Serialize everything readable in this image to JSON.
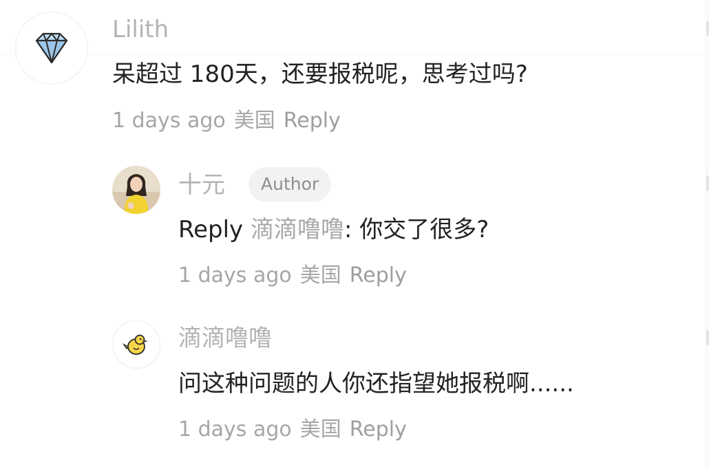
{
  "comments": [
    {
      "username": "Lilith",
      "avatar_icon": "diamond-icon",
      "text": "呆超过 180天，还要报税呢，思考过吗?",
      "time": "1 days ago",
      "location": "美国",
      "reply_label": "Reply",
      "replies": [
        {
          "username": "十元",
          "badge": "Author",
          "avatar_icon": "user-photo-avatar",
          "reply_prefix": "Reply",
          "reply_to": "滴滴噜噜",
          "text": ": 你交了很多?",
          "time": "1 days ago",
          "location": "美国",
          "reply_label": "Reply"
        },
        {
          "username": "滴滴噜噜",
          "avatar_icon": "duck-icon",
          "text": "问这种问题的人你还指望她报税啊......",
          "time": "1 days ago",
          "location": "美国",
          "reply_label": "Reply"
        }
      ]
    }
  ],
  "colors": {
    "text_primary": "#222222",
    "text_secondary": "#a6a6a6",
    "badge_bg": "#f2f2f2",
    "avatar_dress_yellow": "#f2d230",
    "diamond_blue": "#9cc6e8"
  }
}
